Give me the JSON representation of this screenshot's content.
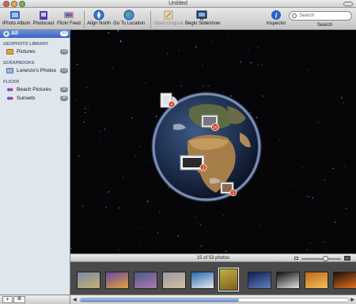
{
  "window": {
    "title": "Untitled"
  },
  "toolbar": {
    "items": [
      {
        "label": "iPhoto Album",
        "icon": "iphoto-album-icon"
      },
      {
        "label": "Photocast",
        "icon": "photocast-icon"
      },
      {
        "label": "Flickr Feed",
        "icon": "flickr-feed-icon"
      },
      {
        "label": "Align North",
        "icon": "compass-icon"
      },
      {
        "label": "Go To Location",
        "icon": "globe-icon"
      },
      {
        "label": "Open Original",
        "icon": "open-original-icon",
        "disabled": true
      },
      {
        "label": "Begin Slideshow",
        "icon": "slideshow-icon"
      },
      {
        "label": "Inspector",
        "icon": "info-icon"
      }
    ],
    "search": {
      "placeholder": "Search",
      "label": "Search"
    }
  },
  "sidebar": {
    "all": {
      "label": "All",
      "count": "53"
    },
    "sections": [
      {
        "heading": "GEOPHOTO LIBRARY",
        "items": [
          {
            "label": "Pictures",
            "count": "13",
            "icon": "folder-icon"
          }
        ]
      },
      {
        "heading": "SCRAPBOOKS",
        "items": [
          {
            "label": "Lorenzo's Photos",
            "count": "13",
            "icon": "scrapbook-icon"
          }
        ]
      },
      {
        "heading": "FLICKR",
        "items": [
          {
            "label": "Beach Pictures",
            "count": "20",
            "icon": "flickr-icon"
          },
          {
            "label": "Sunsets",
            "count": "20",
            "icon": "flickr-icon"
          }
        ]
      }
    ],
    "bottom_buttons": [
      {
        "label": "+"
      },
      {
        "label": "⚙"
      }
    ]
  },
  "map": {
    "markers": [
      {
        "count": "4"
      },
      {
        "count": "16"
      },
      {
        "count": "3"
      },
      {
        "count": "2"
      }
    ]
  },
  "infobar": {
    "status": "15 of 53 photos",
    "zoom_value": 0.6
  },
  "filmstrip": {
    "thumbnails": [
      {
        "color_a": "#7a8aa8",
        "color_b": "#c8b070",
        "selected": false
      },
      {
        "color_a": "#6a4aa0",
        "color_b": "#e0a040",
        "selected": false
      },
      {
        "color_a": "#4a5a8a",
        "color_b": "#b07ab0",
        "selected": false
      },
      {
        "color_a": "#9a9aa0",
        "color_b": "#d0c0a0",
        "selected": false
      },
      {
        "color_a": "#2a6ab0",
        "color_b": "#e8e8f0",
        "selected": false
      },
      {
        "color_a": "#c0b040",
        "color_b": "#806020",
        "selected": true
      },
      {
        "color_a": "#102050",
        "color_b": "#6080c0",
        "selected": false
      },
      {
        "color_a": "#101010",
        "color_b": "#e0e0e0",
        "selected": false
      },
      {
        "color_a": "#c06a10",
        "color_b": "#f0c060",
        "selected": false
      },
      {
        "color_a": "#201008",
        "color_b": "#e07020",
        "selected": false
      }
    ]
  },
  "colors": {
    "accent": "#3a66c2",
    "marker": "#d93a1c",
    "badge": "#7b8796"
  }
}
